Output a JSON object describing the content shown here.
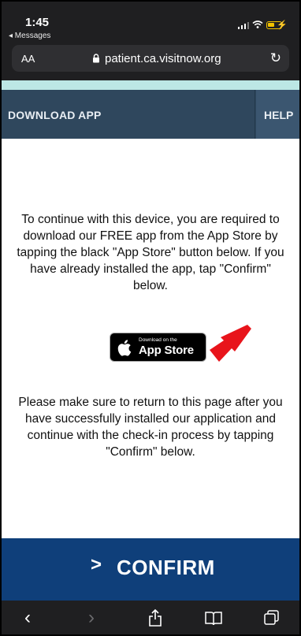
{
  "status_bar": {
    "time": "1:45",
    "back_label": "◂ Messages"
  },
  "browser": {
    "text_size_label": "AA",
    "url": "patient.ca.visitnow.org"
  },
  "nav": {
    "download_label": "DOWNLOAD APP",
    "help_label": "HELP"
  },
  "content": {
    "instructions": "To continue with this device, you are required to download our FREE app from the App Store by tapping the black \"App Store\" button below. If you have already installed the app, tap \"Confirm\" below.",
    "appstore": {
      "small": "Download on the",
      "big": "App Store"
    },
    "return_note": "Please make sure to return to this page after you have successfully installed our application and continue with the check-in process by tapping \"Confirm\" below."
  },
  "confirm": {
    "chevron": ">",
    "label": "CONFIRM"
  },
  "colors": {
    "nav_bg": "#2f475d",
    "teal_strip": "#bce7e5",
    "confirm_bg": "#0f3f7a",
    "arrow": "#e8141b",
    "chrome_bg": "#1f1f21"
  }
}
